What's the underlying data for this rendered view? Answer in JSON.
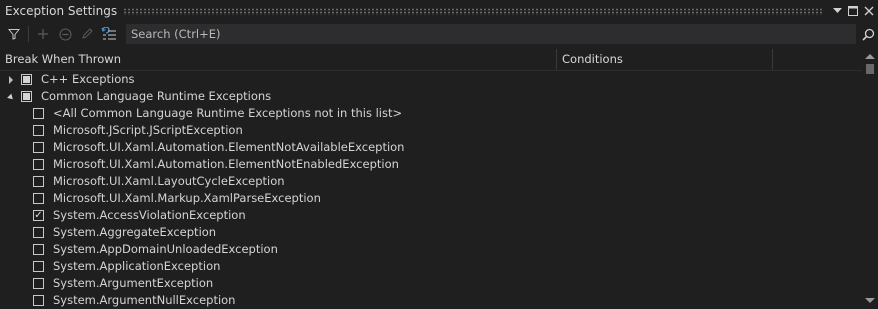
{
  "window": {
    "title": "Exception Settings",
    "dropdown_icon": "chevron-down-icon",
    "maximize_icon": "maximize-icon",
    "close_icon": "close-icon"
  },
  "toolbar": {
    "buttons": [
      {
        "name": "filter-icon",
        "enabled": true
      },
      {
        "name": "add-icon",
        "enabled": false
      },
      {
        "name": "remove-icon",
        "enabled": false
      },
      {
        "name": "edit-icon",
        "enabled": false
      },
      {
        "name": "restore-defaults-icon",
        "enabled": true
      }
    ],
    "search": {
      "placeholder": "Search (Ctrl+E)",
      "value": ""
    }
  },
  "columns": {
    "break_when_thrown": "Break When Thrown",
    "conditions": "Conditions"
  },
  "tree": {
    "groups": [
      {
        "label": "C++ Exceptions",
        "expanded": false,
        "state": "mixed"
      },
      {
        "label": "Common Language Runtime Exceptions",
        "expanded": true,
        "state": "mixed"
      }
    ],
    "clr_items": [
      {
        "label": "<All Common Language Runtime Exceptions not in this list>",
        "checked": false
      },
      {
        "label": "Microsoft.JScript.JScriptException",
        "checked": false
      },
      {
        "label": "Microsoft.UI.Xaml.Automation.ElementNotAvailableException",
        "checked": false
      },
      {
        "label": "Microsoft.UI.Xaml.Automation.ElementNotEnabledException",
        "checked": false
      },
      {
        "label": "Microsoft.UI.Xaml.LayoutCycleException",
        "checked": false
      },
      {
        "label": "Microsoft.UI.Xaml.Markup.XamlParseException",
        "checked": false
      },
      {
        "label": "System.AccessViolationException",
        "checked": true
      },
      {
        "label": "System.AggregateException",
        "checked": false
      },
      {
        "label": "System.AppDomainUnloadedException",
        "checked": false
      },
      {
        "label": "System.ApplicationException",
        "checked": false
      },
      {
        "label": "System.ArgumentException",
        "checked": false
      },
      {
        "label": "System.ArgumentNullException",
        "checked": false
      }
    ]
  },
  "colors": {
    "background": "#1f1f1f",
    "search_background": "#2d2d30",
    "text": "#d4d4d4"
  }
}
